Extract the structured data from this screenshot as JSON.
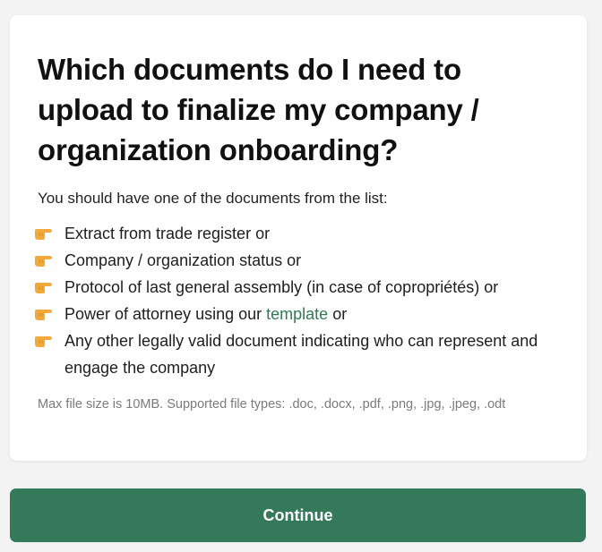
{
  "modal": {
    "title": "Which documents do I need to upload to finalize my company / organization onboarding?",
    "intro": "You should have one of the documents from the list:",
    "documents": [
      {
        "text": "Extract from trade register or",
        "icon": "backhand-index-pointing-right-icon"
      },
      {
        "text": "Company / organization status or",
        "icon": "backhand-index-pointing-right-icon"
      },
      {
        "text": "Protocol of last general assembly (in case of copropriétés) or",
        "icon": "backhand-index-pointing-right-icon"
      },
      {
        "text_before": "Power of attorney using our",
        "link": "template",
        "text_after": " or",
        "icon": "backhand-index-pointing-right-icon"
      },
      {
        "text": "Any other legally valid document indicating who can represent and engage the company",
        "icon": "backhand-index-pointing-right-icon"
      }
    ],
    "file_info": "Max file size is 10MB. Supported file types: .doc, .docx, .pdf, .png, .jpg, .jpeg, .odt"
  },
  "actions": {
    "continue_label": "Continue"
  },
  "colors": {
    "accent": "#35795b",
    "link": "#2f7a56",
    "pointer_icon": "#f2a93b"
  }
}
